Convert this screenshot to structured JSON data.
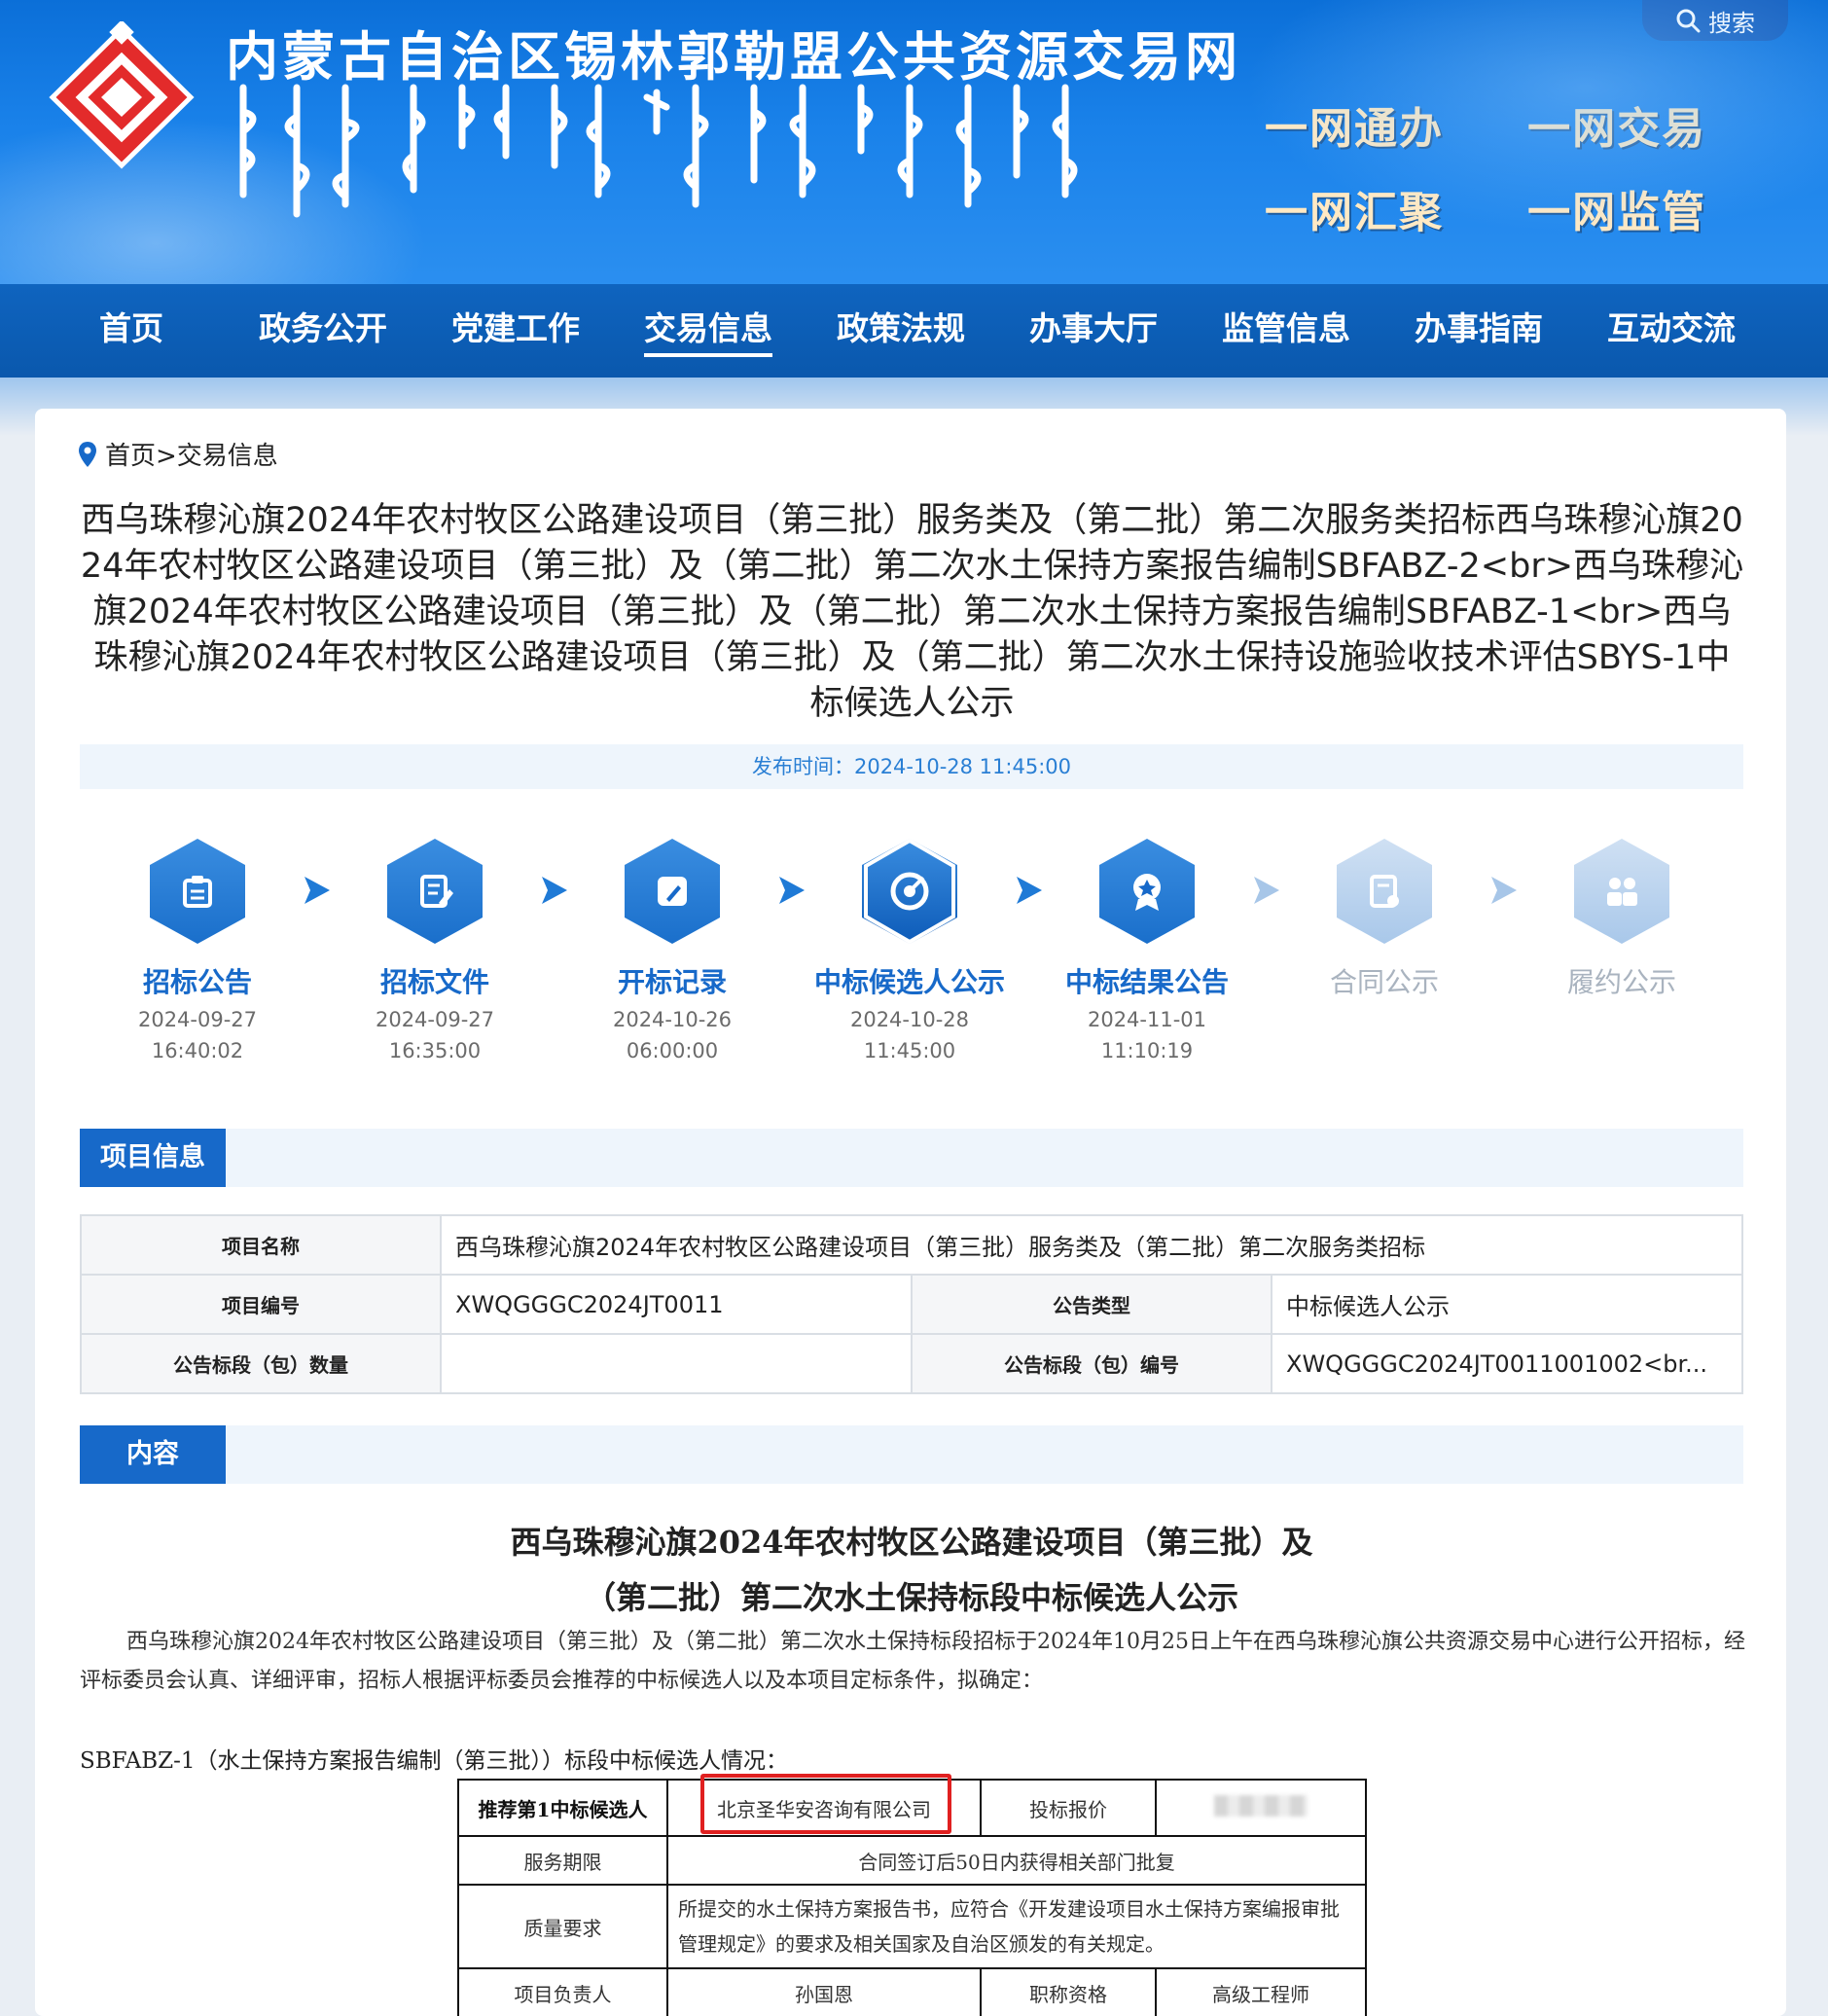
{
  "header": {
    "site_title": "内蒙古自治区锡林郭勒盟公共资源交易网",
    "search_label": "搜索",
    "slogans": [
      "一网通办",
      "一网交易",
      "一网汇聚",
      "一网监管"
    ]
  },
  "nav": {
    "items": [
      "首页",
      "政务公开",
      "党建工作",
      "交易信息",
      "政策法规",
      "办事大厅",
      "监管信息",
      "办事指南",
      "互动交流"
    ],
    "active": "交易信息"
  },
  "breadcrumb": "首页>交易信息",
  "article": {
    "title": "西乌珠穆沁旗2024年农村牧区公路建设项目（第三批）服务类及（第二批）第二次服务类招标西乌珠穆沁旗2024年农村牧区公路建设项目（第三批）及（第二批）第二次水土保持方案报告编制SBFABZ-2<br>西乌珠穆沁旗2024年农村牧区公路建设项目（第三批）及（第二批）第二次水土保持方案报告编制SBFABZ-1<br>西乌珠穆沁旗2024年农村牧区公路建设项目（第三批）及（第二批）第二次水土保持设施验收技术评估SBYS-1中标候选人公示",
    "publish_time": "发布时间：2024-10-28 11:45:00"
  },
  "steps": [
    {
      "label": "招标公告",
      "date": "2024-09-27",
      "time": "16:40:02",
      "active": true,
      "icon": "clipboard-icon"
    },
    {
      "label": "招标文件",
      "date": "2024-09-27",
      "time": "16:35:00",
      "active": true,
      "icon": "document-edit-icon"
    },
    {
      "label": "开标记录",
      "date": "2024-10-26",
      "time": "06:00:00",
      "active": true,
      "icon": "pen-record-icon"
    },
    {
      "label": "中标候选人公示",
      "date": "2024-10-28",
      "time": "11:45:00",
      "active": true,
      "current": true,
      "icon": "target-icon"
    },
    {
      "label": "中标结果公告",
      "date": "2024-11-01",
      "time": "11:10:19",
      "active": true,
      "icon": "award-icon"
    },
    {
      "label": "合同公示",
      "date": "",
      "time": "",
      "active": false,
      "icon": "contract-icon"
    },
    {
      "label": "履约公示",
      "date": "",
      "time": "",
      "active": false,
      "icon": "people-icon"
    }
  ],
  "project_info": {
    "section_label": "项目信息",
    "name_key": "项目名称",
    "name_value": "西乌珠穆沁旗2024年农村牧区公路建设项目（第三批）服务类及（第二批）第二次服务类招标",
    "code_key": "项目编号",
    "code_value": "XWQGGGC2024JT0011",
    "type_key": "公告类型",
    "type_value": "中标候选人公示",
    "qty_key": "公告标段（包）数量",
    "qty_value": "",
    "lot_key": "公告标段（包）编号",
    "lot_value": "XWQGGGC2024JT0011001002<br..."
  },
  "content": {
    "section_label": "内容",
    "title_line1": "西乌珠穆沁旗2024年农村牧区公路建设项目（第三批）及",
    "title_line2": "（第二批）第二次水土保持标段中标候选人公示",
    "paragraph": "西乌珠穆沁旗2024年农村牧区公路建设项目（第三批）及（第二批）第二次水土保持标段招标于2024年10月25日上午在西乌珠穆沁旗公共资源交易中心进行公开招标，经评标委员会认真、详细评审，招标人根据评标委员会推荐的中标候选人以及本项目定标条件，拟确定：",
    "sub_heading": "SBFABZ-1（水土保持方案报告编制（第三批））标段中标候选人情况：",
    "table": {
      "rec_label": "推荐第1中标候选人",
      "rec_value": "北京圣华安咨询有限公司",
      "bid_label": "投标报价",
      "period_label": "服务期限",
      "period_value": "合同签订后50日内获得相关部门批复",
      "quality_label": "质量要求",
      "quality_value": "所提交的水土保持方案报告书，应符合《开发建设项目水土保持方案编报审批管理规定》的要求及相关国家及自治区颁发的有关规定。",
      "leader_label": "项目负责人",
      "leader_value": "孙国恩",
      "title_label": "职称资格",
      "title_value": "高级工程师"
    }
  },
  "colors": {
    "brand_blue": "#1769c9",
    "nav_blue": "#0f64bf",
    "highlight_red": "#e02020"
  }
}
